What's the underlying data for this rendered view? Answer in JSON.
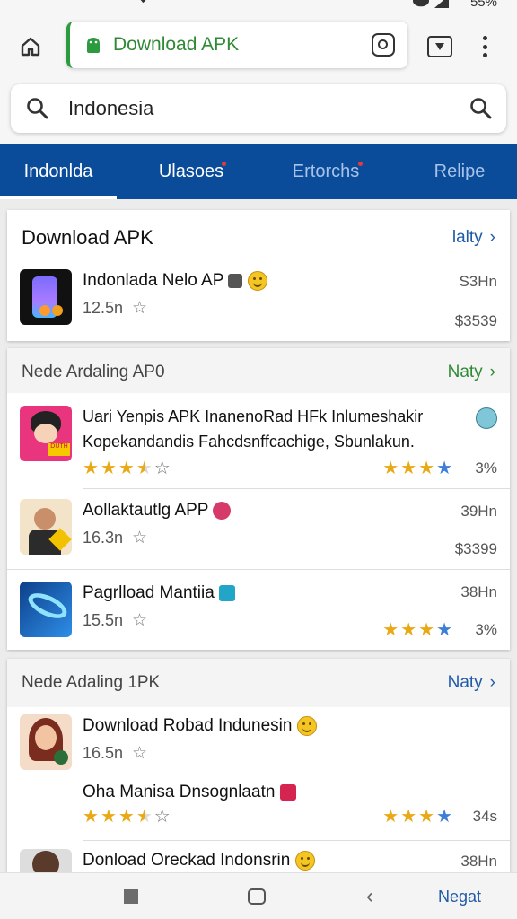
{
  "status": {
    "battery": "55%"
  },
  "browser": {
    "url_title": "Download APK"
  },
  "search": {
    "query": "Indonesia"
  },
  "tabs": [
    {
      "label": "Indonlda",
      "active": true
    },
    {
      "label": "Ulasoes",
      "active": false
    },
    {
      "label": "Ertorchs",
      "active": false
    },
    {
      "label": "Relipe",
      "active": false
    }
  ],
  "section1": {
    "title": "Download APK",
    "more": "lalty",
    "apps": [
      {
        "name": "Indonlada Nelo AP",
        "size": "12.5n",
        "right_top": "S3Hn",
        "right_bottom": "$3539"
      }
    ]
  },
  "section2": {
    "title": "Nede Ardaling AP0",
    "more": "Naty",
    "apps": [
      {
        "name": "Uari Yenpis APK InanenoRad HFk Inlumeshakir",
        "desc": "Kopekandandis Fahcdsnffcachige, Sbunlakun.",
        "rating_right": "3%",
        "stars_left": [
          1,
          1,
          1,
          0.5,
          0
        ],
        "stars_right": [
          "gold",
          "gold",
          "gold",
          "blue"
        ]
      },
      {
        "name": "Aollaktautlg APP",
        "size": "16.3n",
        "right_top": "39Hn",
        "right_bottom": "$3399"
      },
      {
        "name": "Pagrlload Mantiia",
        "size": "15.5n",
        "right_top": "38Hn",
        "rating_right": "3%",
        "stars_right": [
          "gold",
          "gold",
          "gold",
          "blue"
        ]
      }
    ]
  },
  "section3": {
    "title": "Nede Adaling 1PK",
    "more": "Naty",
    "apps": [
      {
        "name": "Download Robad Indunesin",
        "size": "16.5n"
      },
      {
        "name": "Oha Manisa Dnsognlaatn",
        "rating_right": "34s",
        "stars_left": [
          1,
          1,
          1,
          0.5,
          0
        ],
        "stars_right": [
          "gold",
          "gold",
          "gold",
          "blue"
        ]
      },
      {
        "name": "Donload Oreckad Indonsrin",
        "right_top": "38Hn"
      }
    ]
  },
  "navbar": {
    "right_label": "Negat"
  },
  "colors": {
    "tab_bar": "#0a4c9a",
    "accent_green": "#2e8a34",
    "link_blue": "#1f5aa8",
    "star_gold": "#e8a914",
    "star_blue": "#3d7fd6"
  }
}
